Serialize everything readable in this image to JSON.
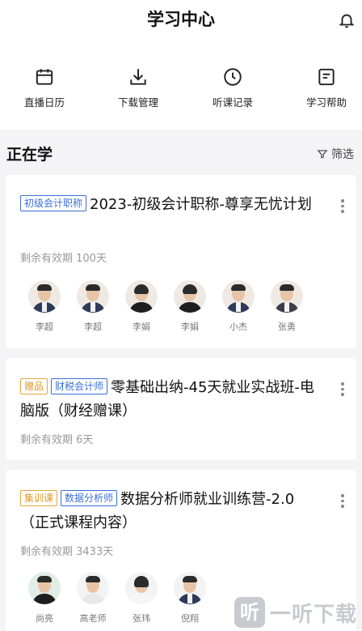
{
  "header": {
    "title": "学习中心"
  },
  "quick_actions": [
    {
      "label": "直播日历",
      "icon": "calendar-icon"
    },
    {
      "label": "下载管理",
      "icon": "download-icon"
    },
    {
      "label": "听课记录",
      "icon": "clock-icon"
    },
    {
      "label": "学习帮助",
      "icon": "help-doc-icon"
    }
  ],
  "section": {
    "title": "正在学",
    "filter_label": "筛选"
  },
  "courses": [
    {
      "tags": [
        "初级会计职称"
      ],
      "title": "2023-初级会计职称-尊享无忧计划",
      "validity": "剩余有效期 100天",
      "teachers": [
        "李超",
        "李超",
        "李娟",
        "李娟",
        "小杰",
        "张勇"
      ]
    },
    {
      "tags": [
        "赠品",
        "财税会计师"
      ],
      "title": "零基础出纳-45天就业实战班-电脑版（财经赠课）",
      "validity": "剩余有效期 6天",
      "teachers": []
    },
    {
      "tags": [
        "集训课",
        "数据分析师"
      ],
      "title": "数据分析师就业训练营-2.0（正式课程内容）",
      "validity": "剩余有效期 3433天",
      "teachers": [
        "尚亮",
        "高老师",
        "张玮",
        "倪翔"
      ]
    }
  ],
  "watermark": {
    "logo": "听",
    "text": "一听下载"
  },
  "colors": {
    "tag_blue": "#3a6fd8",
    "tag_orange": "#e09a2a",
    "background": "#f4f4f6"
  }
}
